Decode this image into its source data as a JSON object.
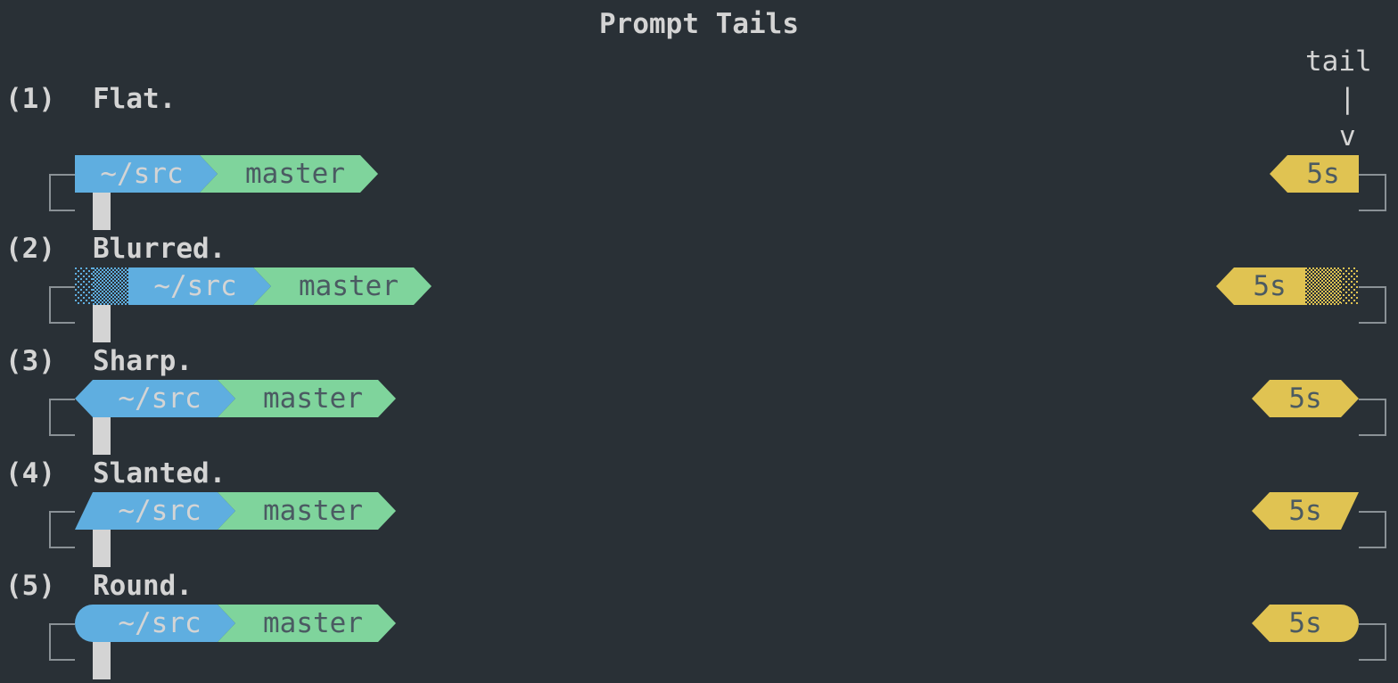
{
  "title": "Prompt Tails",
  "tail_label": "tail",
  "tail_arrow_stem": "|",
  "tail_arrow_head": "v",
  "colors": {
    "background": "#293036",
    "dir": "#5faee0",
    "git": "#7fd49c",
    "time": "#e0c352",
    "segment_text": "#4b5a62",
    "frame": "#8a9196",
    "cursor": "#d4d4d4"
  },
  "rows": [
    {
      "num": "(1)",
      "label": "Flat.",
      "dir": "~/src",
      "branch": "master",
      "time": "5s"
    },
    {
      "num": "(2)",
      "label": "Blurred.",
      "dir": "~/src",
      "branch": "master",
      "time": "5s"
    },
    {
      "num": "(3)",
      "label": "Sharp.",
      "dir": "~/src",
      "branch": "master",
      "time": "5s"
    },
    {
      "num": "(4)",
      "label": "Slanted.",
      "dir": "~/src",
      "branch": "master",
      "time": "5s"
    },
    {
      "num": "(5)",
      "label": "Round.",
      "dir": "~/src",
      "branch": "master",
      "time": "5s"
    }
  ]
}
